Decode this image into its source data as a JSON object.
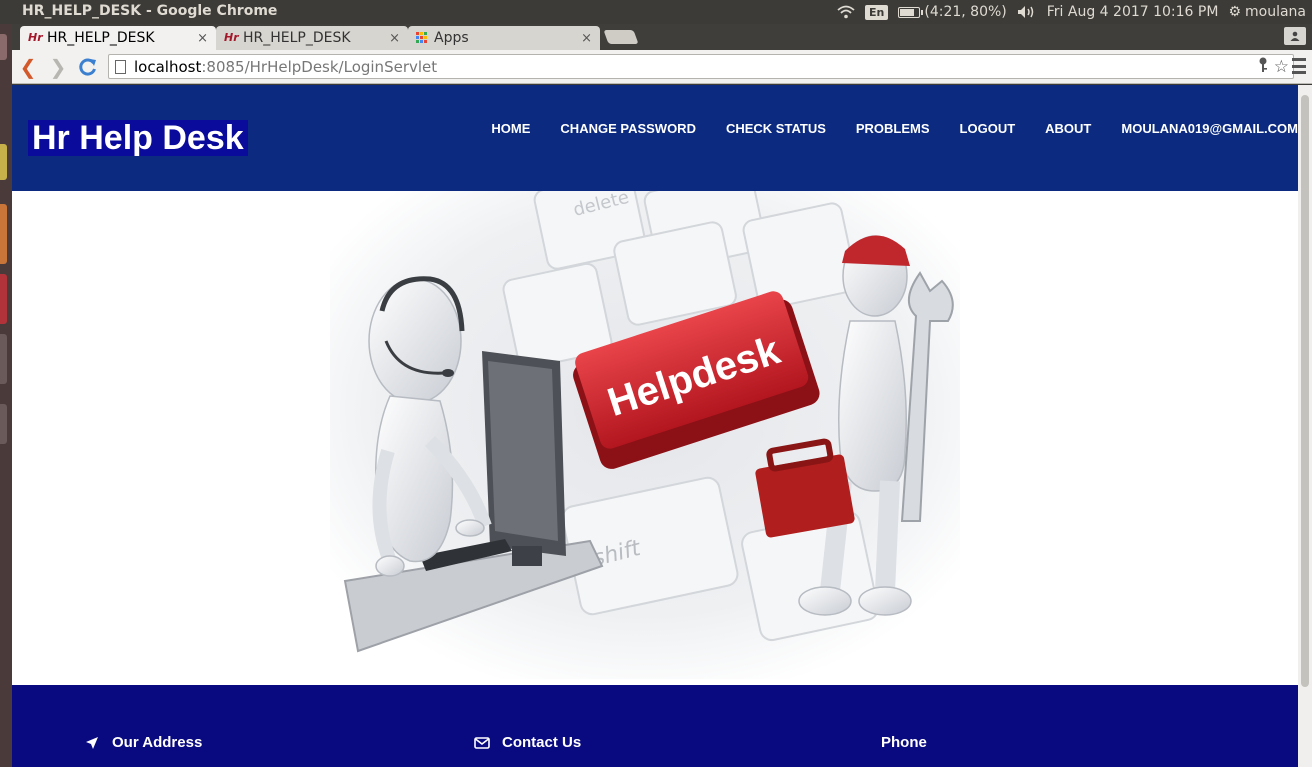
{
  "os": {
    "window_title": "HR_HELP_DESK - Google Chrome",
    "keyboard_layout": "En",
    "battery_text": "(4:21, 80%)",
    "battery_level": 0.8,
    "datetime": "Fri Aug  4 2017 10:16 PM",
    "user": "moulana",
    "icons": [
      "wifi-icon",
      "battery-icon",
      "volume-icon",
      "power-gear-icon"
    ]
  },
  "browser": {
    "tabs": [
      {
        "label": "HR_HELP_DESK",
        "favicon": "hr-logo-icon",
        "active": true
      },
      {
        "label": "HR_HELP_DESK",
        "favicon": "hr-logo-icon",
        "active": false
      },
      {
        "label": "Apps",
        "favicon": "apps-grid-icon",
        "active": false
      }
    ],
    "close_glyph": "×",
    "url_host": "localhost",
    "url_path": ":8085/HrHelpDesk/LoginServlet"
  },
  "site": {
    "brand": "Hr Help Desk",
    "nav": [
      "HOME",
      "CHANGE PASSWORD",
      "CHECK STATUS",
      "PROBLEMS",
      "LOGOUT",
      "ABOUT",
      "MOULANA019@GMAIL.COM"
    ],
    "hero": {
      "key_label": "Helpdesk",
      "key_hint_shift": "shift",
      "key_hint_delete": "delete",
      "colors": {
        "key_red": "#d5232d",
        "toolbox_red": "#b01e1e",
        "figure": "#e9ecf0"
      }
    },
    "footer": {
      "address_title": "Our Address",
      "contact_title": "Contact Us",
      "phone_title": "Phone"
    },
    "colors": {
      "header_bg": "#0b2a80",
      "footer_bg": "#0a0a80",
      "brand_bg": "#0a0a9b"
    }
  }
}
